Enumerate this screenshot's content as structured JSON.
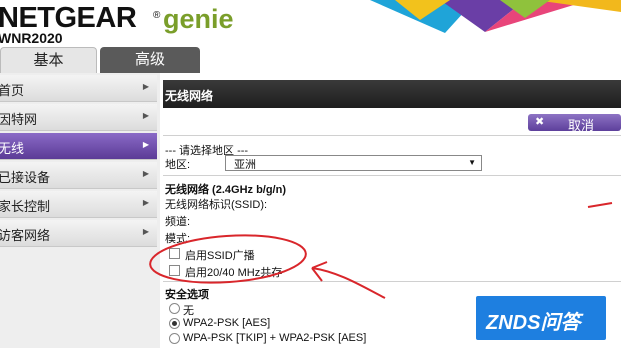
{
  "header": {
    "brand": "NETGEAR",
    "brand_mark": "®",
    "product": "genie",
    "model": "WNR2020"
  },
  "tabs": [
    {
      "label": "基本",
      "active": true
    },
    {
      "label": "高级",
      "active": false
    }
  ],
  "sidebar": {
    "items": [
      {
        "label": "首页"
      },
      {
        "label": "因特网"
      },
      {
        "label": "无线",
        "active": true
      },
      {
        "label": "已接设备"
      },
      {
        "label": "家长控制"
      },
      {
        "label": "访客网络"
      }
    ]
  },
  "panel": {
    "title": "无线网络",
    "cancel_label": "取消",
    "region_heading": "--- 请选择地区 ---",
    "region_label": "地区:",
    "region_value": "亚洲",
    "wireless_heading": "无线网络 (2.4GHz b/g/n)",
    "ssid_label": "无线网络标识(SSID):",
    "channel_label": "频道:",
    "mode_label": "模式:",
    "enable_ssid_broadcast": "启用SSID广播",
    "enable_2040": "启用20/40 MHz共存",
    "security_heading": "安全选项",
    "security_options": [
      {
        "label": "无",
        "selected": false
      },
      {
        "label": "WPA2-PSK [AES]",
        "selected": true
      },
      {
        "label": "WPA-PSK [TKIP] + WPA2-PSK [AES]",
        "selected": false
      }
    ]
  },
  "watermark": "ZNDS问答",
  "colors": {
    "accent": "#6a4bb0",
    "genie_green": "#7a9e2a",
    "annotation_red": "#d9262b"
  }
}
